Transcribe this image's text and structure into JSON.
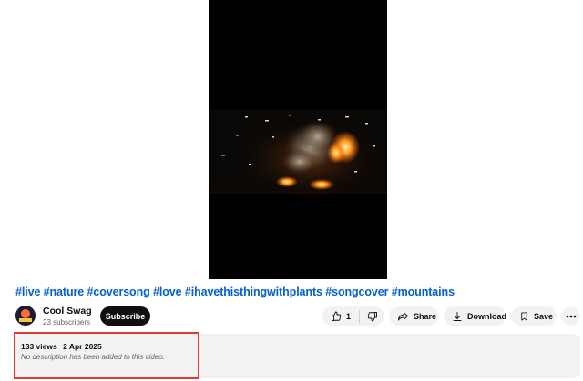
{
  "video": {
    "player_state": "playing"
  },
  "title": "#live #nature #coversong #love #ihavethisthingwithplants #songcover #mountains",
  "channel": {
    "name": "Cool Swag",
    "subscribers": "23 subscribers",
    "subscribe_label": "Subscribe"
  },
  "actions": {
    "like_count": "1",
    "share_label": "Share",
    "download_label": "Download",
    "save_label": "Save"
  },
  "description": {
    "views": "133 views",
    "date": "2 Apr 2025",
    "text": "No description has been added to this video."
  },
  "colors": {
    "accent_title": "#065fd4",
    "subscribe_bg": "#0f0f0f",
    "pill_bg": "#f2f2f2",
    "highlight": "#e53935"
  },
  "icons": {
    "like": "thumbs-up-icon",
    "dislike": "thumbs-down-icon",
    "share": "share-arrow-icon",
    "download": "download-icon",
    "save": "bookmark-icon",
    "more": "more-horizontal-icon"
  }
}
